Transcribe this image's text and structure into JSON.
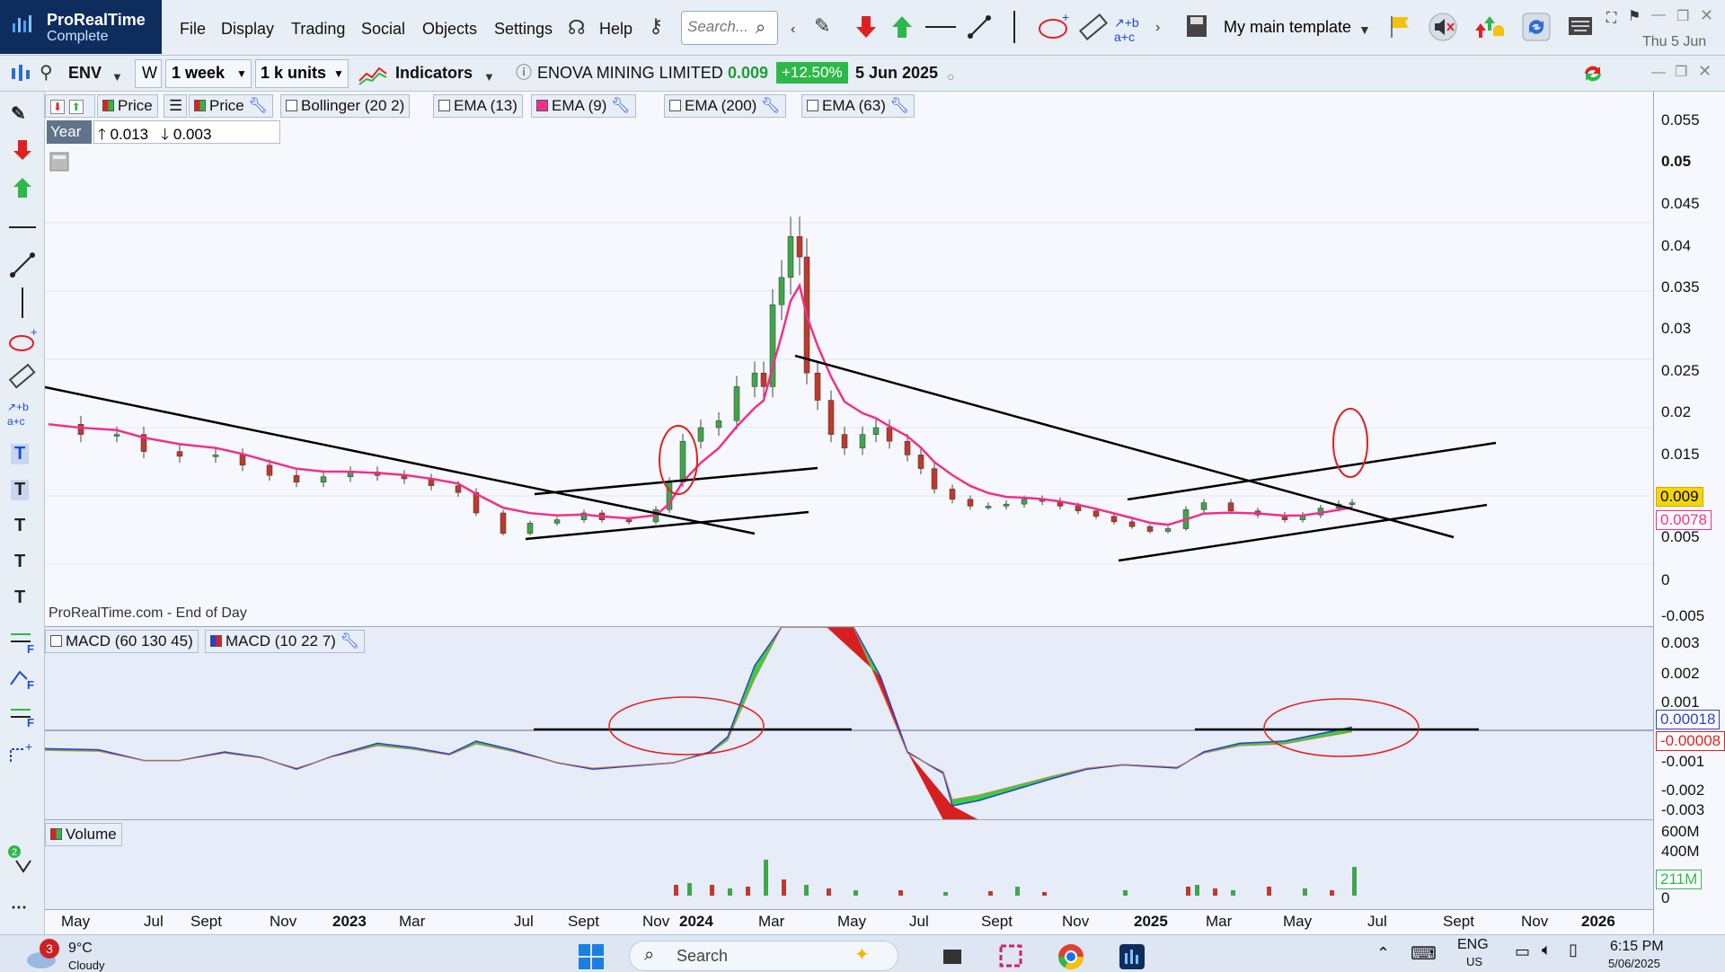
{
  "app": {
    "brand": "ProRealTime",
    "edition": "Complete"
  },
  "menu": [
    "File",
    "Display",
    "Trading",
    "Social",
    "Objects",
    "Settings"
  ],
  "help_label": "Help",
  "search": {
    "placeholder": "Search..."
  },
  "template": "My main template",
  "top_date": "Thu 5 Jun",
  "symbol": {
    "ticker": "ENV",
    "period_letter": "W",
    "timeframe": "1 week",
    "units": "1 k units",
    "indicators_label": "Indicators",
    "name": "ENOVA MINING LIMITED",
    "price": "0.009",
    "change": "+12.50%",
    "date": "5 Jun 2025"
  },
  "legend_price": [
    "Price",
    "Price",
    "Bollinger (20 2)",
    "EMA (13)",
    "EMA (9)",
    "EMA (200)",
    "EMA (63)"
  ],
  "year_row": {
    "label": "Year",
    "high": "0.013",
    "low": "0.003"
  },
  "watermark": "ProRealTime.com - End of Day",
  "price_axis": [
    "0.055",
    "0.05",
    "0.045",
    "0.04",
    "0.035",
    "0.03",
    "0.025",
    "0.02",
    "0.015",
    "0.01",
    "0.005",
    "0",
    "-0.005"
  ],
  "price_tags": {
    "last": "0.009",
    "ema": "0.0078"
  },
  "macd_legend": [
    "MACD (60 130 45)",
    "MACD (10 22 7)"
  ],
  "macd_axis": [
    "0.003",
    "0.002",
    "0.001",
    "-0.001",
    "-0.002",
    "-0.003"
  ],
  "macd_tags": {
    "a": "0.00018",
    "b": "-0.00008"
  },
  "volume_legend": "Volume",
  "volume_axis": [
    "600M",
    "400M",
    "0"
  ],
  "volume_tag": "211M",
  "x_axis": [
    "May",
    "Jul",
    "Sept",
    "Nov",
    "2023",
    "Mar",
    "Jul",
    "Sept",
    "Nov",
    "2024",
    "Mar",
    "May",
    "Jul",
    "Sept",
    "Nov",
    "2025",
    "Mar",
    "May",
    "Jul",
    "Sept",
    "Nov",
    "2026"
  ],
  "colors": {
    "up": "#3fa64a",
    "down": "#c0392b",
    "ema": "#f0308a",
    "trend": "#000000",
    "annot": "#e02020",
    "macd_up": "#36d040",
    "macd_down": "#d62020"
  },
  "taskbar": {
    "weather_badge": "3",
    "temperature": "9°C",
    "weather_text": "Cloudy",
    "search": "Search",
    "language": "ENG",
    "language_sub": "US",
    "time": "6:15 PM",
    "date": "5/06/2025"
  }
}
